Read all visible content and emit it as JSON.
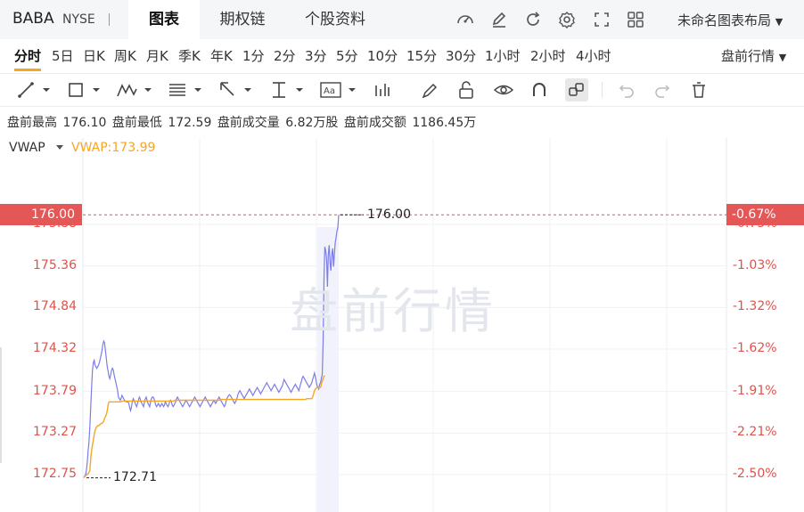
{
  "header": {
    "symbol": "BABA",
    "exchange": "NYSE",
    "tabs": [
      {
        "label": "图表",
        "active": true
      },
      {
        "label": "期权链",
        "active": false
      },
      {
        "label": "个股资料",
        "active": false
      }
    ],
    "icons": [
      "gauge-icon",
      "edit-icon",
      "refresh-icon",
      "settings-icon",
      "fullscreen-icon",
      "grid-layout-icon"
    ],
    "layout_label": "未命名图表布局"
  },
  "periods": {
    "items": [
      "分时",
      "5日",
      "日K",
      "周K",
      "月K",
      "季K",
      "年K",
      "1分",
      "2分",
      "3分",
      "5分",
      "10分",
      "15分",
      "30分",
      "1小时",
      "2小时",
      "4小时"
    ],
    "active": "分时",
    "session_label": "盘前行情"
  },
  "toolbar": {
    "tools": [
      "trend-line-icon",
      "rectangle-icon",
      "pattern-icon",
      "fib-icon",
      "arrow-icon",
      "measure-icon",
      "text-icon",
      "indicator-icon",
      "brush-icon",
      "lock-icon",
      "eye-icon",
      "magnet-icon",
      "link-icon",
      "undo-icon",
      "redo-icon",
      "delete-icon"
    ]
  },
  "stats": {
    "high_label": "盘前最高",
    "high_value": "176.10",
    "low_label": "盘前最低",
    "low_value": "172.59",
    "volume_label": "盘前成交量",
    "volume_value": "6.82万股",
    "amount_label": "盘前成交额",
    "amount_value": "1186.45万"
  },
  "indicator": {
    "name": "VWAP",
    "value_text": "VWAP:173.99",
    "color": "#f5a623"
  },
  "chart_data": {
    "type": "line",
    "watermark": "盘前行情",
    "current_price": "176.00",
    "current_change": "-0.67%",
    "high_marker": "176.00",
    "low_marker": "172.71",
    "y_ticks": [
      "175.88",
      "175.36",
      "174.84",
      "174.32",
      "173.79",
      "173.27",
      "172.75"
    ],
    "pct_ticks": [
      "-0.73%",
      "-1.03%",
      "-1.32%",
      "-1.62%",
      "-1.91%",
      "-2.21%",
      "-2.50%"
    ],
    "ylim": [
      172.75,
      175.88
    ],
    "line_color": "#7b7de8",
    "vwap_color": "#f5a623",
    "up_color": "#e45756",
    "series": [
      {
        "name": "VWAP",
        "values": [
          172.72,
          172.72,
          172.74,
          172.74,
          172.76,
          172.76,
          172.78,
          172.8,
          172.95,
          173.06,
          173.12,
          173.18,
          173.25,
          173.3,
          173.33,
          173.35,
          173.36,
          173.36,
          173.37,
          173.38,
          173.39,
          173.39,
          173.4,
          173.42,
          173.45,
          173.48,
          173.5,
          173.55,
          173.62,
          173.66,
          173.66,
          173.66,
          173.66,
          173.66,
          173.66,
          173.66,
          173.66,
          173.66,
          173.66,
          173.66,
          173.66,
          173.66,
          173.66,
          173.66,
          173.67,
          173.67,
          173.67,
          173.67,
          173.67,
          173.67,
          173.67,
          173.67,
          173.67,
          173.67,
          173.67,
          173.67,
          173.67,
          173.67,
          173.67,
          173.67,
          173.67,
          173.67,
          173.67,
          173.67,
          173.67,
          173.67,
          173.67,
          173.67,
          173.67,
          173.67,
          173.67,
          173.67,
          173.67,
          173.67,
          173.67,
          173.67,
          173.67,
          173.67,
          173.67,
          173.67,
          173.67,
          173.67,
          173.67,
          173.67,
          173.67,
          173.67,
          173.67,
          173.67,
          173.67,
          173.67,
          173.67,
          173.67,
          173.67,
          173.67,
          173.67,
          173.67,
          173.67,
          173.67,
          173.67,
          173.67,
          173.67,
          173.67,
          173.67,
          173.67,
          173.67,
          173.68,
          173.68,
          173.68,
          173.68,
          173.68,
          173.68,
          173.68,
          173.68,
          173.68,
          173.68,
          173.68,
          173.68,
          173.68,
          173.68,
          173.68,
          173.68,
          173.68,
          173.68,
          173.68,
          173.68,
          173.68,
          173.68,
          173.68,
          173.68,
          173.68,
          173.68,
          173.68,
          173.68,
          173.68,
          173.68,
          173.68,
          173.68,
          173.68,
          173.68,
          173.68,
          173.68,
          173.68,
          173.68,
          173.68,
          173.68,
          173.68,
          173.68,
          173.68,
          173.68,
          173.68,
          173.68,
          173.68,
          173.68,
          173.68,
          173.68,
          173.68,
          173.68,
          173.68,
          173.69,
          173.69,
          173.69,
          173.69,
          173.69,
          173.69,
          173.69,
          173.69,
          173.69,
          173.69,
          173.69,
          173.69,
          173.69,
          173.69,
          173.69,
          173.69,
          173.69,
          173.69,
          173.69,
          173.69,
          173.69,
          173.69,
          173.69,
          173.69,
          173.69,
          173.69,
          173.69,
          173.69,
          173.69,
          173.69,
          173.69,
          173.69,
          173.69,
          173.69,
          173.69,
          173.69,
          173.69,
          173.69,
          173.69,
          173.69,
          173.69,
          173.69,
          173.69,
          173.69,
          173.69,
          173.69,
          173.69,
          173.69,
          173.69,
          173.69,
          173.69,
          173.69,
          173.69,
          173.69,
          173.69,
          173.69,
          173.69,
          173.69,
          173.69,
          173.69,
          173.69,
          173.69,
          173.69,
          173.69,
          173.69,
          173.69,
          173.69,
          173.69,
          173.69,
          173.69,
          173.69,
          173.69,
          173.69,
          173.69,
          173.69,
          173.69,
          173.69,
          173.69,
          173.69,
          173.69,
          173.69,
          173.69,
          173.69,
          173.69,
          173.69,
          173.69,
          173.69,
          173.69,
          173.69,
          173.69,
          173.69,
          173.69,
          173.69,
          173.69,
          173.69,
          173.69,
          173.69,
          173.69,
          173.69,
          173.7,
          173.7,
          173.7,
          173.7,
          173.7,
          173.7,
          173.7,
          173.72,
          173.76,
          173.8,
          173.82,
          173.83,
          173.84,
          173.84,
          173.84,
          173.84,
          173.84,
          173.88,
          173.92,
          173.95,
          173.98,
          173.99
        ]
      },
      {
        "name": "price",
        "values": [
          172.71,
          172.73,
          172.75,
          172.8,
          172.9,
          173.05,
          173.15,
          173.35,
          173.6,
          173.85,
          174.05,
          174.15,
          174.18,
          174.12,
          174.1,
          174.08,
          174.1,
          174.12,
          174.15,
          174.2,
          174.25,
          174.3,
          174.38,
          174.42,
          174.4,
          174.3,
          174.2,
          174.1,
          174.05,
          173.98,
          173.95,
          174.0,
          174.05,
          174.08,
          174.06,
          174.0,
          173.95,
          173.9,
          173.85,
          173.8,
          173.72,
          173.7,
          173.68,
          173.7,
          173.74,
          173.72,
          173.7,
          173.68,
          173.67,
          173.66,
          173.66,
          173.66,
          173.64,
          173.58,
          173.55,
          173.6,
          173.66,
          173.7,
          173.68,
          173.65,
          173.62,
          173.6,
          173.64,
          173.68,
          173.72,
          173.7,
          173.66,
          173.64,
          173.62,
          173.6,
          173.66,
          173.7,
          173.72,
          173.68,
          173.64,
          173.62,
          173.6,
          173.66,
          173.7,
          173.72,
          173.72,
          173.7,
          173.66,
          173.62,
          173.6,
          173.62,
          173.64,
          173.62,
          173.6,
          173.62,
          173.64,
          173.62,
          173.6,
          173.62,
          173.66,
          173.64,
          173.62,
          173.6,
          173.62,
          173.66,
          173.68,
          173.66,
          173.62,
          173.6,
          173.62,
          173.64,
          173.66,
          173.7,
          173.72,
          173.7,
          173.68,
          173.66,
          173.64,
          173.62,
          173.6,
          173.62,
          173.64,
          173.66,
          173.68,
          173.66,
          173.64,
          173.62,
          173.6,
          173.62,
          173.64,
          173.66,
          173.68,
          173.7,
          173.72,
          173.7,
          173.68,
          173.66,
          173.64,
          173.62,
          173.6,
          173.62,
          173.64,
          173.66,
          173.68,
          173.7,
          173.72,
          173.7,
          173.68,
          173.66,
          173.64,
          173.62,
          173.6,
          173.62,
          173.64,
          173.66,
          173.68,
          173.66,
          173.64,
          173.66,
          173.68,
          173.7,
          173.72,
          173.7,
          173.68,
          173.66,
          173.64,
          173.62,
          173.6,
          173.62,
          173.66,
          173.7,
          173.72,
          173.74,
          173.75,
          173.74,
          173.72,
          173.7,
          173.68,
          173.66,
          173.64,
          173.66,
          173.68,
          173.72,
          173.76,
          173.78,
          173.8,
          173.78,
          173.76,
          173.74,
          173.72,
          173.7,
          173.72,
          173.74,
          173.76,
          173.78,
          173.8,
          173.82,
          173.8,
          173.78,
          173.76,
          173.74,
          173.76,
          173.78,
          173.8,
          173.82,
          173.84,
          173.82,
          173.8,
          173.78,
          173.76,
          173.78,
          173.8,
          173.82,
          173.84,
          173.86,
          173.88,
          173.9,
          173.88,
          173.86,
          173.84,
          173.82,
          173.8,
          173.82,
          173.84,
          173.86,
          173.88,
          173.86,
          173.84,
          173.82,
          173.8,
          173.78,
          173.8,
          173.82,
          173.84,
          173.86,
          173.9,
          173.94,
          173.92,
          173.9,
          173.88,
          173.86,
          173.84,
          173.82,
          173.8,
          173.78,
          173.8,
          173.82,
          173.84,
          173.86,
          173.88,
          173.86,
          173.84,
          173.82,
          173.8,
          173.84,
          173.88,
          173.92,
          173.96,
          173.98,
          173.96,
          173.94,
          173.92,
          173.9,
          173.88,
          173.86,
          173.84,
          173.86,
          173.88,
          173.9,
          173.94,
          173.98,
          174.02,
          173.98,
          173.92,
          173.86,
          173.84,
          173.82,
          173.88,
          173.9,
          173.95,
          174.0,
          174.4,
          175.2,
          175.6,
          175.55,
          175.45,
          175.1,
          175.5,
          175.62,
          175.4,
          175.3,
          175.5,
          175.58,
          175.35,
          175.5,
          175.65,
          175.72,
          175.8,
          175.84,
          176.0
        ]
      }
    ]
  }
}
